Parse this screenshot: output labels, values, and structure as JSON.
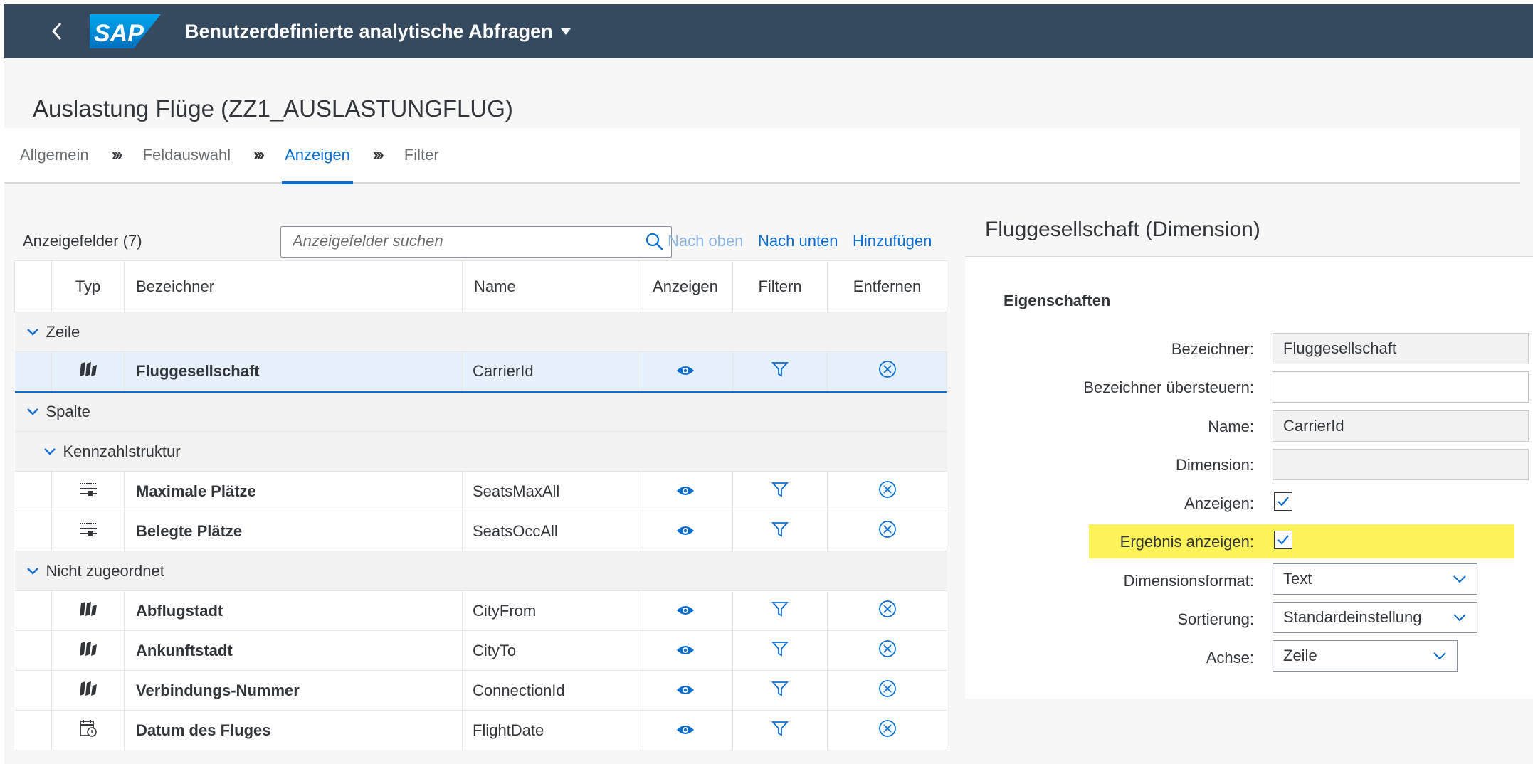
{
  "shell": {
    "logo_text": "SAP",
    "app_title": "Benutzerdefinierte analytische Abfragen"
  },
  "page": {
    "object_title": "Auslastung Flüge (ZZ1_AUSLASTUNGFLUG)"
  },
  "steps": [
    {
      "label": "Allgemein",
      "active": false
    },
    {
      "label": "Feldauswahl",
      "active": false
    },
    {
      "label": "Anzeigen",
      "active": true
    },
    {
      "label": "Filter",
      "active": false
    }
  ],
  "toolbar": {
    "count_label": "Anzeigefelder (7)",
    "search_placeholder": "Anzeigefelder suchen",
    "move_up": "Nach oben",
    "move_down": "Nach unten",
    "add": "Hinzufügen"
  },
  "table": {
    "columns": [
      "Typ",
      "Bezeichner",
      "Name",
      "Anzeigen",
      "Filtern",
      "Entfernen"
    ],
    "groups": {
      "zeile": "Zeile",
      "spalte": "Spalte",
      "kennzahl": "Kennzahlstruktur",
      "nicht": "Nicht zugeordnet"
    },
    "rows": {
      "fluggesellschaft": {
        "label": "Fluggesellschaft",
        "name": "CarrierId",
        "icon": "dimension-icon"
      },
      "max_plaetze": {
        "label": "Maximale Plätze",
        "name": "SeatsMaxAll",
        "icon": "measure-icon"
      },
      "belegte_plaetze": {
        "label": "Belegte Plätze",
        "name": "SeatsOccAll",
        "icon": "measure-icon"
      },
      "abflugstadt": {
        "label": "Abflugstadt",
        "name": "CityFrom",
        "icon": "dimension-icon"
      },
      "ankunftstadt": {
        "label": "Ankunftstadt",
        "name": "CityTo",
        "icon": "dimension-icon"
      },
      "verbindung": {
        "label": "Verbindungs-Nummer",
        "name": "ConnectionId",
        "icon": "dimension-icon"
      },
      "datum": {
        "label": "Datum des Fluges",
        "name": "FlightDate",
        "icon": "calendar-icon"
      }
    }
  },
  "details": {
    "title": "Fluggesellschaft (Dimension)",
    "section": "Eigenschaften",
    "labels": {
      "bezeichner": "Bezeichner:",
      "override": "Bezeichner übersteuern:",
      "name": "Name:",
      "dimension": "Dimension:",
      "anzeigen": "Anzeigen:",
      "ergebnis": "Ergebnis anzeigen:",
      "format": "Dimensionsformat:",
      "sortierung": "Sortierung:",
      "achse": "Achse:"
    },
    "values": {
      "bezeichner": "Fluggesellschaft",
      "override": "",
      "name": "CarrierId",
      "dimension": "",
      "anzeigen_checked": true,
      "ergebnis_checked": true,
      "format": "Text",
      "sortierung": "Standardeinstellung",
      "achse": "Zeile"
    }
  },
  "colors": {
    "shell": "#354a5f",
    "accent": "#0a6ed1",
    "highlight": "#fff35a"
  }
}
